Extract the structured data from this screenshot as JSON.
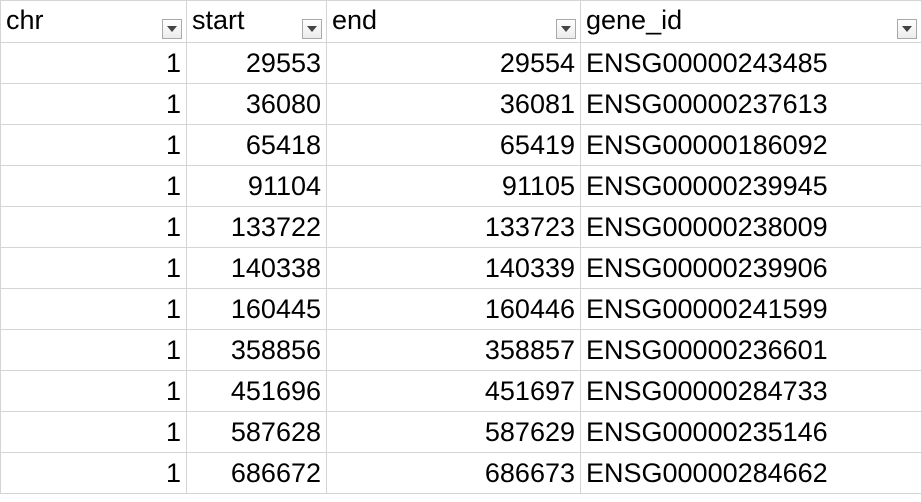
{
  "headers": [
    {
      "key": "chr",
      "label": "chr"
    },
    {
      "key": "start",
      "label": "start"
    },
    {
      "key": "end",
      "label": "end"
    },
    {
      "key": "gene_id",
      "label": "gene_id"
    }
  ],
  "rows": [
    {
      "chr": "1",
      "start": "29553",
      "end": "29554",
      "gene_id": "ENSG00000243485"
    },
    {
      "chr": "1",
      "start": "36080",
      "end": "36081",
      "gene_id": "ENSG00000237613"
    },
    {
      "chr": "1",
      "start": "65418",
      "end": "65419",
      "gene_id": "ENSG00000186092"
    },
    {
      "chr": "1",
      "start": "91104",
      "end": "91105",
      "gene_id": "ENSG00000239945"
    },
    {
      "chr": "1",
      "start": "133722",
      "end": "133723",
      "gene_id": "ENSG00000238009"
    },
    {
      "chr": "1",
      "start": "140338",
      "end": "140339",
      "gene_id": "ENSG00000239906"
    },
    {
      "chr": "1",
      "start": "160445",
      "end": "160446",
      "gene_id": "ENSG00000241599"
    },
    {
      "chr": "1",
      "start": "358856",
      "end": "358857",
      "gene_id": "ENSG00000236601"
    },
    {
      "chr": "1",
      "start": "451696",
      "end": "451697",
      "gene_id": "ENSG00000284733"
    },
    {
      "chr": "1",
      "start": "587628",
      "end": "587629",
      "gene_id": "ENSG00000235146"
    },
    {
      "chr": "1",
      "start": "686672",
      "end": "686673",
      "gene_id": "ENSG00000284662"
    }
  ],
  "icons": {
    "filter": "filter-dropdown-arrow-icon"
  },
  "colors": {
    "gridline": "#d4d4d4",
    "filter_border": "#a9a9a9",
    "text": "#000000"
  }
}
